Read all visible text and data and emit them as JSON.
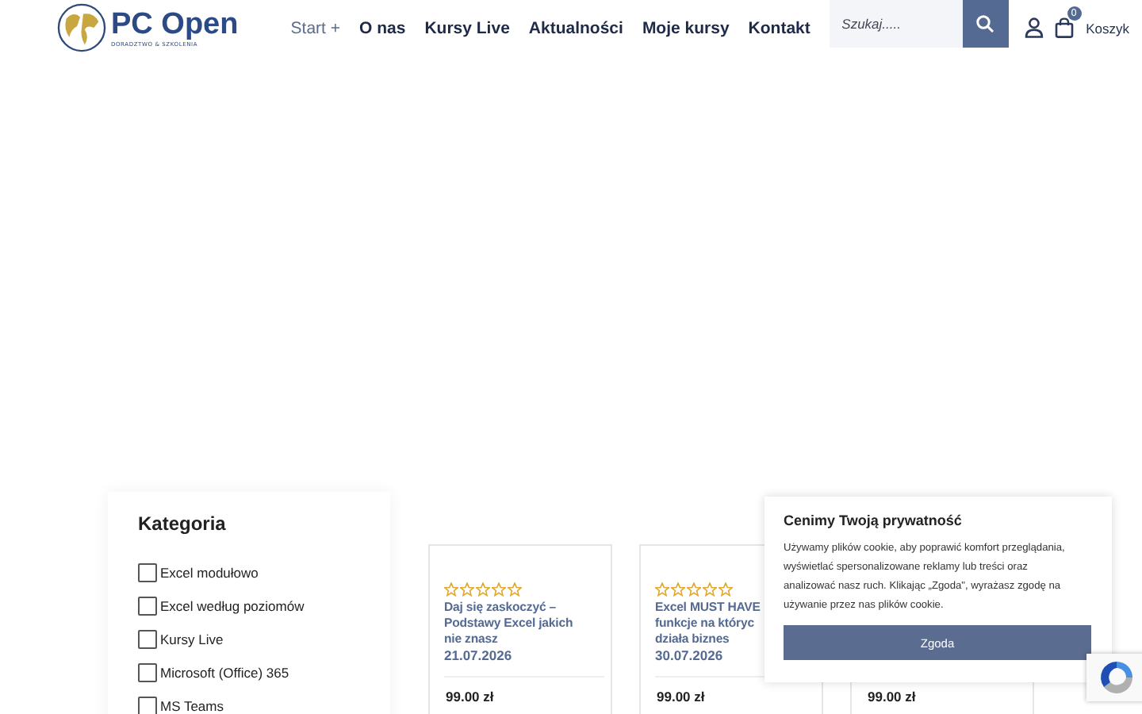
{
  "header": {
    "logo": {
      "name": "PC Open",
      "tagline": "DORADZTWO & SZKOLENIA"
    },
    "nav": [
      {
        "label": "Start +",
        "selected": true
      },
      {
        "label": "O nas",
        "selected": false
      },
      {
        "label": "Kursy Live",
        "selected": false
      },
      {
        "label": "Aktualności",
        "selected": false
      },
      {
        "label": "Moje kursy",
        "selected": false
      },
      {
        "label": "Kontakt",
        "selected": false
      }
    ],
    "search": {
      "placeholder": "Szukaj....."
    },
    "cart": {
      "count": "0",
      "label": "Koszyk"
    }
  },
  "sidebar": {
    "title": "Kategoria",
    "items": [
      {
        "label": "Excel modułowo",
        "checked": false
      },
      {
        "label": "Excel według poziomów",
        "checked": false
      },
      {
        "label": "Kursy Live",
        "checked": false
      },
      {
        "label": "Microsoft (Office) 365",
        "checked": false
      },
      {
        "label": "MS Teams",
        "checked": false
      }
    ]
  },
  "products": [
    {
      "stars": 0,
      "title": "Daj się zaskoczyć –\nPodstawy Excel jakich\nnie znasz",
      "date": "21.07.2026",
      "price": "99.00 zł"
    },
    {
      "stars": 0,
      "title": "Excel MUST HAVE\nfunkcje na któryc\ndziała biznes",
      "date": "30.07.2026",
      "price": "99.00 zł"
    },
    {
      "price": "99.00 zł"
    }
  ],
  "cookie": {
    "title": "Cenimy Twoją prywatność",
    "text": "Używamy plików cookie, aby poprawić komfort przeglądania, wyświetlać spersonalizowane reklamy lub treści oraz analizować nasz ruch. Klikając „Zgoda\", wyrażasz zgodę na używanie przez nas plików cookie.",
    "button": "Zgoda"
  }
}
